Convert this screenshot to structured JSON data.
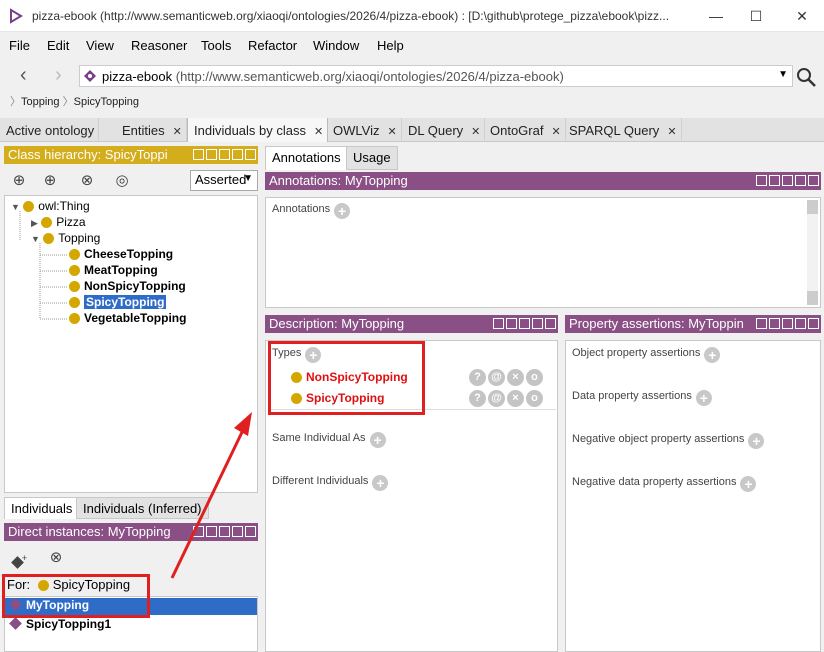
{
  "window": {
    "title": "pizza-ebook (http://www.semanticweb.org/xiaoqi/ontologies/2026/4/pizza-ebook)  : [D:\\github\\protege_pizza\\ebook\\pizz...",
    "minimize": "—",
    "maximize": "☐",
    "close": "✕"
  },
  "menu": [
    "File",
    "Edit",
    "View",
    "Reasoner",
    "Tools",
    "Refactor",
    "Window",
    "Help"
  ],
  "address": {
    "name": "pizza-ebook",
    "uri": "(http://www.semanticweb.org/xiaoqi/ontologies/2026/4/pizza-ebook)"
  },
  "breadcrumb": [
    "Topping",
    "SpicyTopping"
  ],
  "tabs": [
    {
      "label": "Active ontology",
      "closable": false
    },
    {
      "label": "Entities",
      "closable": true
    },
    {
      "label": "Individuals by class",
      "closable": true,
      "active": true
    },
    {
      "label": "OWLViz",
      "closable": true
    },
    {
      "label": "DL Query",
      "closable": true
    },
    {
      "label": "OntoGraf",
      "closable": true
    },
    {
      "label": "SPARQL Query",
      "closable": true
    }
  ],
  "class_hierarchy": {
    "title": "Class hierarchy: SpicyToppi",
    "mode": "Asserted",
    "tree": [
      {
        "label": "owl:Thing"
      },
      {
        "label": "Pizza"
      },
      {
        "label": "Topping"
      },
      {
        "label": "CheeseTopping"
      },
      {
        "label": "MeatTopping"
      },
      {
        "label": "NonSpicyTopping"
      },
      {
        "label": "SpicyTopping"
      },
      {
        "label": "VegetableTopping"
      }
    ]
  },
  "individuals": {
    "tabs": [
      "Individuals",
      "Individuals (Inferred)"
    ],
    "title": "Direct instances: MyTopping",
    "for_label": "For:",
    "for_class": "SpicyTopping",
    "items": [
      "MyTopping",
      "SpicyTopping1"
    ]
  },
  "right_tabs": [
    "Annotations",
    "Usage"
  ],
  "annotations": {
    "title": "Annotations: MyTopping",
    "section": "Annotations"
  },
  "description": {
    "title": "Description: MyTopping",
    "types_label": "Types",
    "types": [
      "NonSpicyTopping",
      "SpicyTopping"
    ],
    "same_individual": "Same Individual As",
    "different_individuals": "Different Individuals",
    "row_buttons": [
      "?",
      "@",
      "×",
      "o"
    ]
  },
  "property_assertions": {
    "title": "Property assertions: MyToppin",
    "sections": [
      "Object property assertions",
      "Data property assertions",
      "Negative object property assertions",
      "Negative data property assertions"
    ]
  },
  "colors": {
    "class_header": "#d4ad1c",
    "individual_header": "#8a4f84",
    "selection": "#2e6cc8",
    "annotation_box": "#e02020"
  }
}
